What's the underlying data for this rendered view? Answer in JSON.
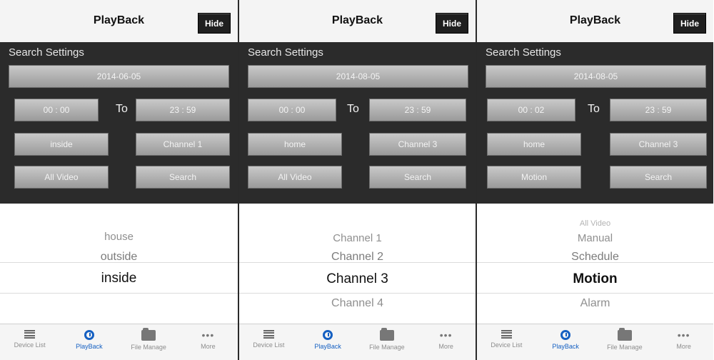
{
  "tabs": [
    "Device List",
    "PlayBack",
    "File Manage",
    "More"
  ],
  "screens": [
    {
      "title": "PlayBack",
      "hide": "Hide",
      "settings_title": "Search Settings",
      "date": "2014-06-05",
      "start": "00 : 00",
      "to": "To",
      "end": "23 : 59",
      "location": "inside",
      "channel": "Channel 1",
      "type": "All Video",
      "search": "Search",
      "picker": [
        "house",
        "outside",
        "inside"
      ]
    },
    {
      "title": "PlayBack",
      "hide": "Hide",
      "settings_title": "Search Settings",
      "date": "2014-08-05",
      "start": "00 : 00",
      "to": "To",
      "end": "23 : 59",
      "location": "home",
      "channel": "Channel 3",
      "type": "All Video",
      "search": "Search",
      "picker": [
        "Channel 1",
        "Channel 2",
        "Channel 3",
        "Channel 4"
      ]
    },
    {
      "title": "PlayBack",
      "hide": "Hide",
      "settings_title": "Search Settings",
      "date": "2014-08-05",
      "start": "00 : 02",
      "to": "To",
      "end": "23 : 59",
      "location": "home",
      "channel": "Channel 3",
      "type": "Motion",
      "search": "Search",
      "picker": [
        "All Video",
        "Manual",
        "Schedule",
        "Motion",
        "Alarm"
      ]
    }
  ]
}
